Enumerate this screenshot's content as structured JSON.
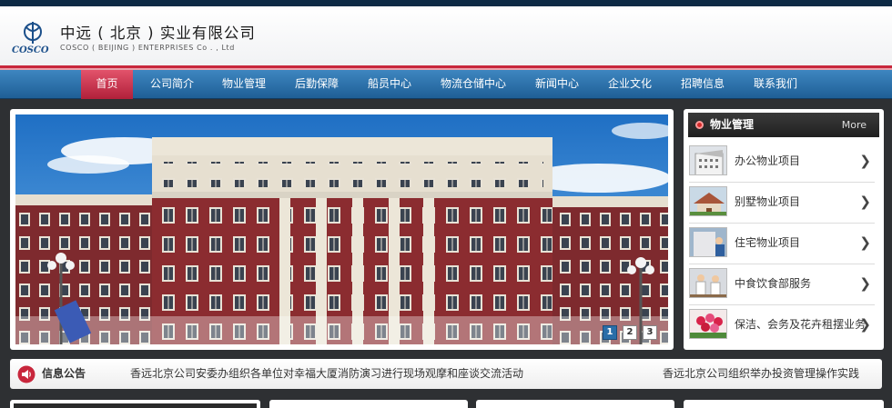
{
  "header": {
    "company_cn": "中远 ( 北京 ) 实业有限公司",
    "company_en": "COSCO ( BEIJING ) ENTERPRISES Co . ,   Ltd",
    "logo_text": "COSCO"
  },
  "nav": {
    "items": [
      {
        "label": "首页",
        "active": true
      },
      {
        "label": "公司简介"
      },
      {
        "label": "物业管理"
      },
      {
        "label": "后勤保障"
      },
      {
        "label": "船员中心"
      },
      {
        "label": "物流仓储中心"
      },
      {
        "label": "新闻中心"
      },
      {
        "label": "企业文化"
      },
      {
        "label": "招聘信息"
      },
      {
        "label": "联系我们"
      }
    ]
  },
  "slider": {
    "pages": [
      "1",
      "2",
      "3"
    ],
    "active_page": 1
  },
  "sidebar": {
    "title": "物业管理",
    "more": "More",
    "items": [
      {
        "label": "办公物业项目",
        "icon": "office-building-thumb"
      },
      {
        "label": "别墅物业项目",
        "icon": "villa-thumb"
      },
      {
        "label": "住宅物业项目",
        "icon": "residential-thumb"
      },
      {
        "label": "中食饮食部服务",
        "icon": "dining-thumb"
      },
      {
        "label": "保洁、会务及花卉租摆业务",
        "icon": "flowers-thumb"
      }
    ]
  },
  "notice": {
    "title": "信息公告",
    "items": [
      "香远北京公司安委办组织各单位对幸福大厦消防演习进行现场观摩和座谈交流活动",
      "香远北京公司组织举办投资管理操作实践"
    ]
  },
  "colors": {
    "nav_blue": "#2a6ea8",
    "accent_red": "#c8273c",
    "dark_bg": "#2e3033"
  }
}
